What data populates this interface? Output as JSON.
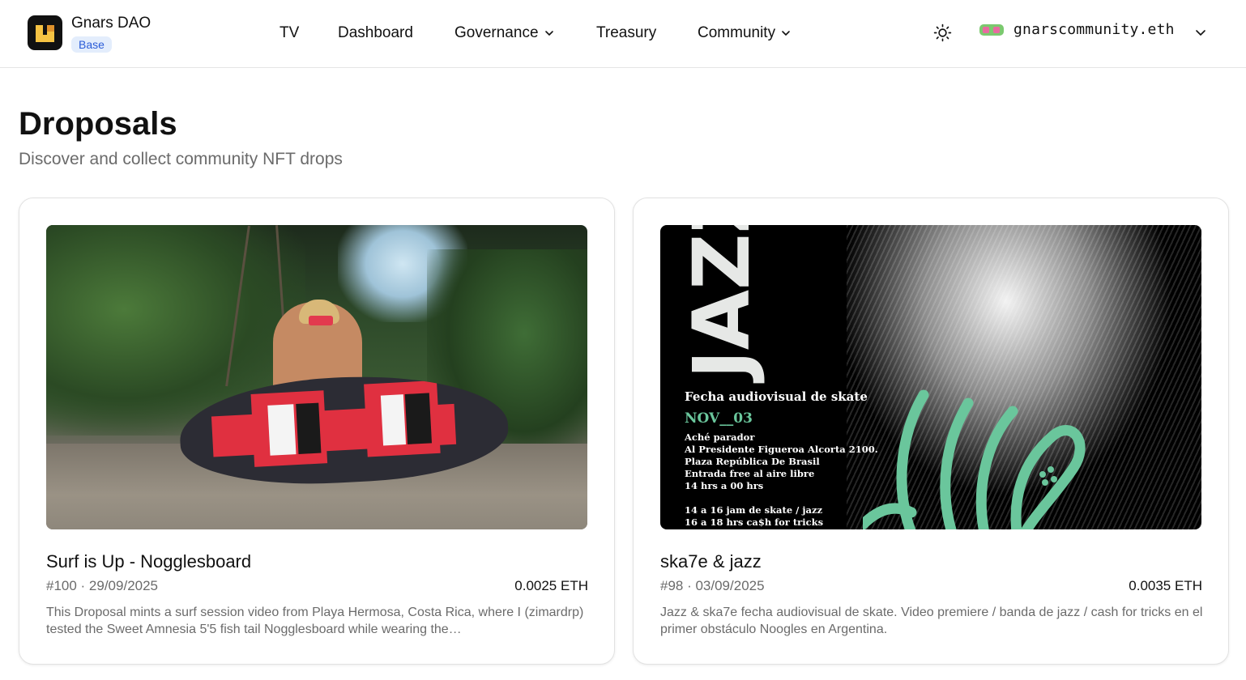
{
  "header": {
    "brand_name": "Gnars DAO",
    "chain_badge": "Base",
    "nav": [
      {
        "label": "TV",
        "has_menu": false
      },
      {
        "label": "Dashboard",
        "has_menu": false
      },
      {
        "label": "Governance",
        "has_menu": true
      },
      {
        "label": "Treasury",
        "has_menu": false
      },
      {
        "label": "Community",
        "has_menu": true
      }
    ],
    "theme_icon": "sun-icon",
    "account": {
      "name": "gnarscommunity.eth",
      "avatar_icon": "noggles-avatar-icon",
      "menu_icon": "chevron-down-icon"
    }
  },
  "page": {
    "title": "Droposals",
    "subtitle": "Discover and collect community NFT drops"
  },
  "droposals": [
    {
      "title": "Surf is Up - Nogglesboard",
      "meta": "#100 · 29/09/2025",
      "price": "0.0025 ETH",
      "description": "This Droposal mints a surf session video from Playa Hermosa, Costa Rica, where I (zimardrp) tested the Sweet Amnesia 5'5 fish tail Nogglesboard while wearing the…"
    },
    {
      "title": "ska7e & jazz",
      "meta": "#98 · 03/09/2025",
      "price": "0.0035 ETH",
      "description": "Jazz & ska7e fecha audiovisual de skate. Video premiere / banda de jazz / cash for tricks en el primer obstáculo Noogles en Argentina.",
      "poster": {
        "big_word": "JAZZ",
        "heading": "Fecha audiovisual de skate",
        "date": "NOV__03",
        "lines": [
          "Aché parador",
          "Al Presidente Figueroa Alcorta 2100.",
          "Plaza República De Brasil",
          "Entrada free al aire libre",
          "14 hrs a 00 hrs"
        ],
        "schedule": [
          "14 a 16 jam de skate / jazz",
          "16 a 18 hrs ca$h for tricks"
        ]
      }
    }
  ],
  "colors": {
    "badge_bg": "#e3edfc",
    "badge_text": "#2a5bd7",
    "poster_accent": "#6ac69c",
    "muted_text": "#6b6b6b"
  }
}
